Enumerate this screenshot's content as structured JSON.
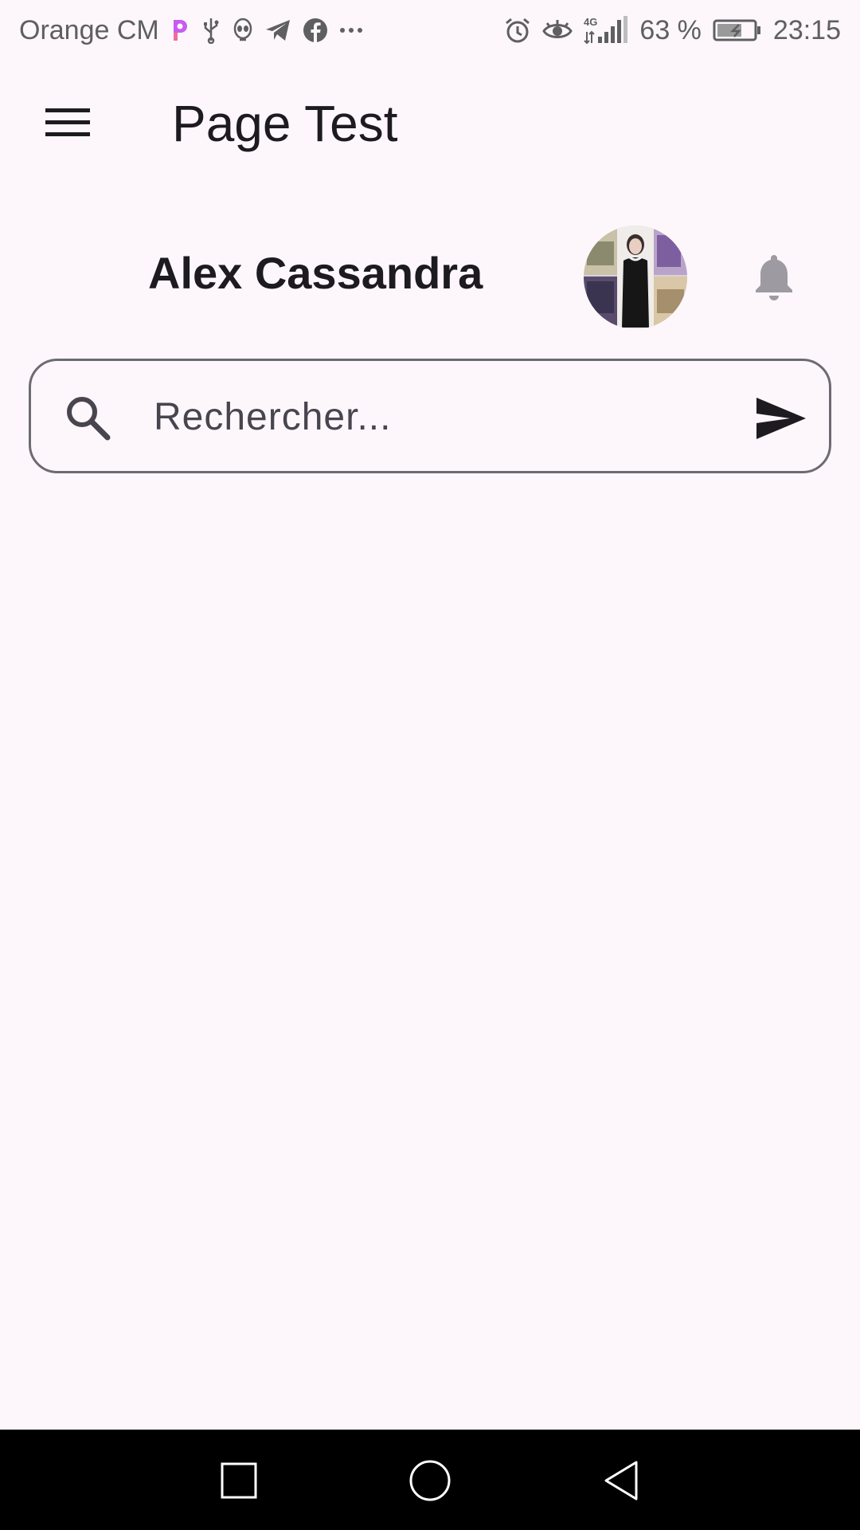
{
  "status_bar": {
    "carrier": "Orange CM",
    "network": "4G",
    "battery_percent": "63 %",
    "time": "23:15",
    "left_icons": [
      "picsart-icon",
      "usb-icon",
      "alien-icon",
      "telegram-icon",
      "facebook-icon",
      "more-dots-icon"
    ],
    "right_icons": [
      "alarm-icon",
      "eye-icon",
      "signal-icon",
      "battery-icon"
    ]
  },
  "app_bar": {
    "title": "Page Test",
    "menu_icon": "menu-icon"
  },
  "profile": {
    "name": "Alex Cassandra",
    "avatar_icon": "avatar-photo",
    "notification_icon": "bell-icon"
  },
  "search": {
    "placeholder": "Rechercher...",
    "value": "",
    "search_icon": "search-icon",
    "send_icon": "send-icon"
  },
  "nav_bar": {
    "buttons": [
      "recents-square-icon",
      "home-circle-icon",
      "back-triangle-icon"
    ]
  },
  "colors": {
    "background": "#FDF7FC",
    "text_primary": "#1D1B20",
    "outline": "#6E6A72",
    "bell": "#9E9AA2",
    "nav_bar": "#000000"
  }
}
